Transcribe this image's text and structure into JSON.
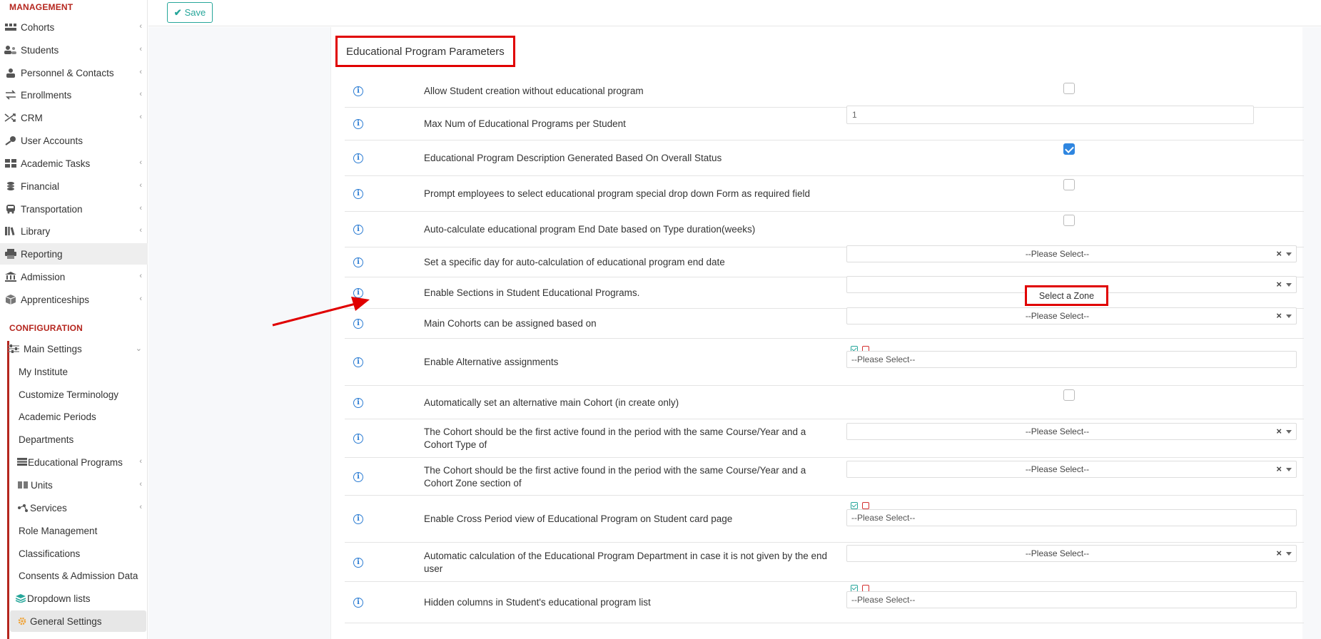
{
  "sidebar": {
    "management_title": "MANAGEMENT",
    "management_items": [
      {
        "label": "Cohorts",
        "icon": "cohorts-icon",
        "chevron": true
      },
      {
        "label": "Students",
        "icon": "students-icon",
        "chevron": true
      },
      {
        "label": "Personnel & Contacts",
        "icon": "personnel-icon",
        "chevron": true
      },
      {
        "label": "Enrollments",
        "icon": "enrollments-icon",
        "chevron": true
      },
      {
        "label": "CRM",
        "icon": "crm-icon",
        "chevron": true
      },
      {
        "label": "User Accounts",
        "icon": "key-icon",
        "chevron": false
      },
      {
        "label": "Academic Tasks",
        "icon": "grid-icon",
        "chevron": true
      },
      {
        "label": "Financial",
        "icon": "coins-icon",
        "chevron": true
      },
      {
        "label": "Transportation",
        "icon": "bus-icon",
        "chevron": true
      },
      {
        "label": "Library",
        "icon": "books-icon",
        "chevron": true
      },
      {
        "label": "Reporting",
        "icon": "printer-icon",
        "chevron": false,
        "active": true
      },
      {
        "label": "Admission",
        "icon": "bank-icon",
        "chevron": true
      },
      {
        "label": "Apprenticeships",
        "icon": "cube-icon",
        "chevron": true
      }
    ],
    "configuration_title": "CONFIGURATION",
    "main_settings_label": "Main Settings",
    "config_items": [
      {
        "label": "My Institute",
        "chevron": false
      },
      {
        "label": "Customize Terminology",
        "chevron": false
      },
      {
        "label": "Academic Periods",
        "chevron": false
      },
      {
        "label": "Departments",
        "chevron": false
      },
      {
        "label": "Educational Programs",
        "chevron": true,
        "icon": "programs-icon"
      },
      {
        "label": "Units",
        "chevron": true,
        "icon": "book-icon"
      },
      {
        "label": "Services",
        "chevron": true,
        "icon": "services-icon"
      },
      {
        "label": "Role Management",
        "chevron": false
      },
      {
        "label": "Classifications",
        "chevron": false
      },
      {
        "label": "Consents & Admission Data",
        "chevron": false
      },
      {
        "label": "Dropdown lists",
        "chevron": false,
        "icon": "layers-icon"
      },
      {
        "label": "General Settings",
        "chevron": false,
        "icon": "gear-icon",
        "active": true
      }
    ]
  },
  "toolbar": {
    "save_label": "Save"
  },
  "panel": {
    "title": "Educational Program Parameters",
    "rows": [
      {
        "label": "Allow Student creation without educational program",
        "control": "checkbox",
        "checked": false
      },
      {
        "label": "Max Num of Educational Programs per Student",
        "control": "text",
        "value": "1"
      },
      {
        "label": "Educational Program Description Generated Based On Overall Status",
        "control": "checkbox",
        "checked": true
      },
      {
        "label": "Prompt employees to select educational program special drop down Form as required field",
        "control": "checkbox",
        "checked": false
      },
      {
        "label": "Auto-calculate educational program End Date based on Type duration(weeks)",
        "control": "checkbox",
        "checked": false
      },
      {
        "label": "Set a specific day for auto-calculation of educational program end date",
        "control": "select",
        "value": "--Please Select--"
      },
      {
        "label": "Enable Sections in Student Educational Programs.",
        "control": "select",
        "value": ""
      },
      {
        "label": "Main Cohorts can be assigned based on",
        "control": "select",
        "value": "--Please Select--"
      },
      {
        "label": "Enable Alternative assignments",
        "control": "multi",
        "value": "--Please Select--"
      },
      {
        "label": "Automatically set an alternative main Cohort (in create only)",
        "control": "checkbox",
        "checked": false
      },
      {
        "label": "The Cohort should be the first active found in the period with the same Course/Year and a Cohort Type of",
        "control": "select",
        "value": "--Please Select--"
      },
      {
        "label": "The Cohort should be the first active found in the period with the same Course/Year and a Cohort Zone section of",
        "control": "select",
        "value": "--Please Select--"
      },
      {
        "label": "Enable Cross Period view of Educational Program on Student card page",
        "control": "multi",
        "value": "--Please Select--"
      },
      {
        "label": "Automatic calculation of the Educational Program Department in case it is not given by the end user",
        "control": "select",
        "value": "--Please Select--"
      },
      {
        "label": "Hidden columns in Student's educational program list",
        "control": "multi",
        "value": "--Please Select--"
      }
    ],
    "zone_placeholder": "Select a Zone",
    "clear_symbol": "×",
    "info_symbol": "i"
  },
  "colors": {
    "accent_red": "#b5261e",
    "highlight_red": "#e00000",
    "teal": "#26a69a",
    "blue": "#2f86e0"
  }
}
